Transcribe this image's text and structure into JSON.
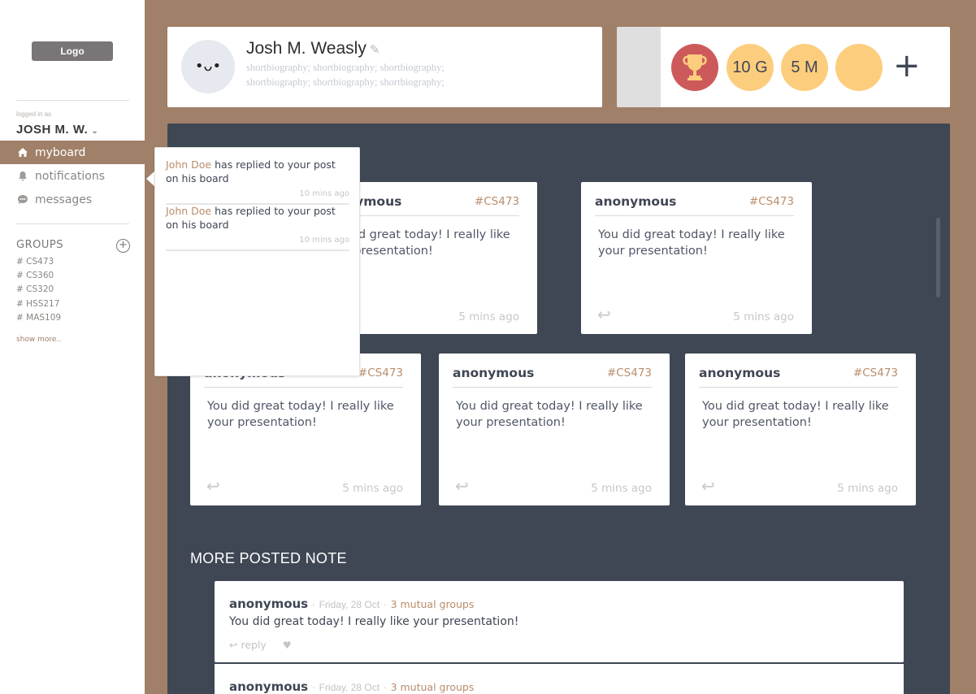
{
  "sidebar": {
    "logo": "Logo",
    "logged_in_label": "logged in as",
    "user_name": "JOSH M. W.",
    "nav": [
      {
        "label": "myboard",
        "icon": "home-icon"
      },
      {
        "label": "notifications",
        "icon": "bell-icon"
      },
      {
        "label": "messages",
        "icon": "chat-icon"
      }
    ],
    "groups_title": "GROUPS",
    "groups": [
      "CS473",
      "CS360",
      "CS320",
      "HSS217",
      "MAS109"
    ],
    "show_more": "show more.."
  },
  "profile": {
    "name": "Josh M. Weasly",
    "bio": "shortbiography; shortbiography; shortbiography; shortbiography; shortbiography; shortbiography;",
    "avatar_face": "•ᴗ•"
  },
  "badges": {
    "items": [
      "",
      "10 G",
      "5 M",
      ""
    ]
  },
  "notes": [
    {
      "author": "anonymous",
      "tag": "#CS473",
      "text": "You did great today! I really like your presentation!",
      "time": "5 mins ago"
    },
    {
      "author": "anonymous",
      "tag": "#CS473",
      "text": "You did great today! I really like your presentation!",
      "time": "5 mins ago"
    },
    {
      "author": "anonymous",
      "tag": "#CS473",
      "text": "You did great today! I really like your presentation!",
      "time": "5 mins ago"
    },
    {
      "author": "anonymous",
      "tag": "#CS473",
      "text": "You did great today! I really like your presentation!",
      "time": "5 mins ago"
    },
    {
      "author": "anonymous",
      "tag": "#CS473",
      "text": "You did great today! I really like your presentation!",
      "time": "5 mins ago"
    }
  ],
  "more_notes_title": "MORE POSTED NOTE",
  "posts": [
    {
      "author": "anonymous",
      "date": "Friday, 28 Oct",
      "groups": "3 mutual groups",
      "text": "You did great today! I really like your presentation!",
      "reply": "reply"
    },
    {
      "author": "anonymous",
      "date": "Friday, 28 Oct",
      "groups": "3 mutual groups"
    }
  ],
  "notifications": [
    {
      "name": "John Doe",
      "text": "has replied to your post on his board",
      "time": "10 mins ago"
    },
    {
      "name": "John Doe",
      "text": "has replied to your post on his board",
      "time": "10 mins ago"
    }
  ],
  "colors": {
    "brand": "#a08068",
    "panel": "#3f4754",
    "badge": "#fdcd7e",
    "trophy": "#cd5a5a",
    "accent_text": "#b98d6b"
  }
}
